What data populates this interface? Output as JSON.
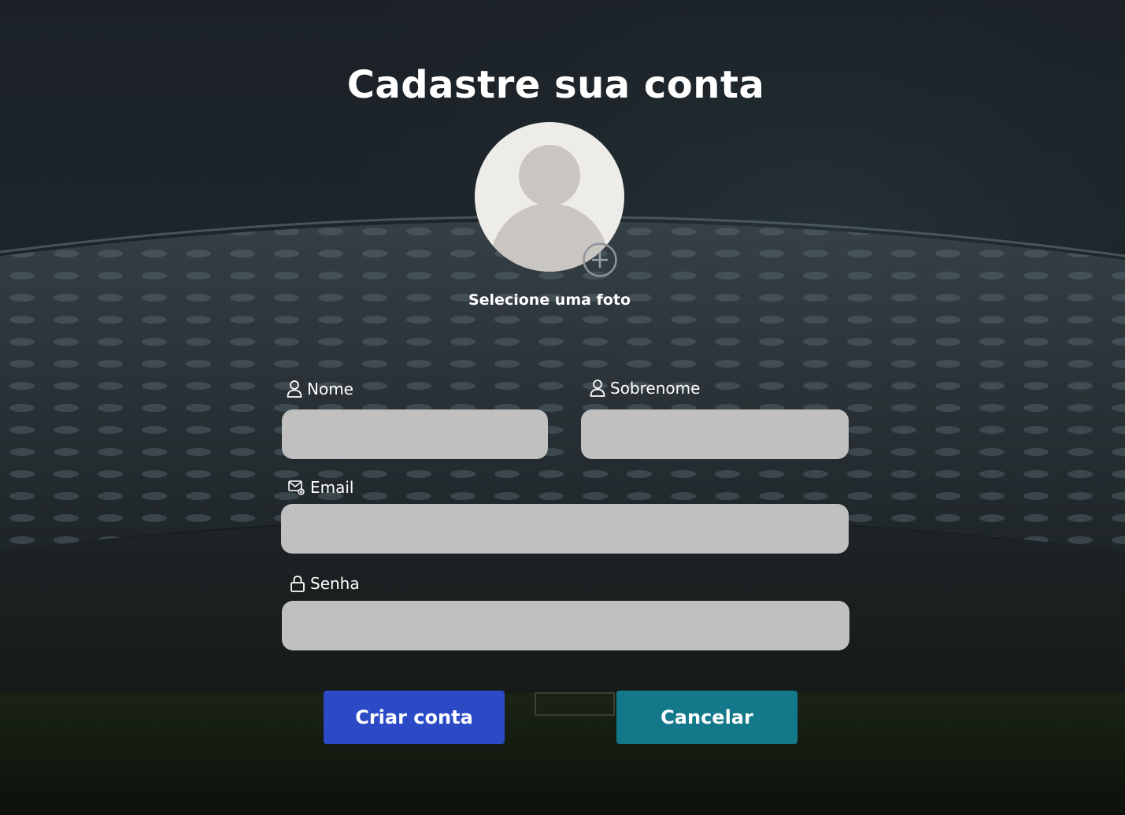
{
  "page": {
    "title": "Cadastre sua conta"
  },
  "photo": {
    "label": "Selecione uma foto",
    "add_icon": "plus-circle-icon",
    "avatar_icon": "user-silhouette-icon"
  },
  "form": {
    "first_name": {
      "label": "Nome",
      "icon": "user-icon",
      "value": ""
    },
    "last_name": {
      "label": "Sobrenome",
      "icon": "user-icon",
      "value": ""
    },
    "email": {
      "label": "Email",
      "icon": "mail-at-icon",
      "value": ""
    },
    "password": {
      "label": "Senha",
      "icon": "lock-icon",
      "value": ""
    }
  },
  "actions": {
    "create_label": "Criar conta",
    "cancel_label": "Cancelar"
  },
  "colors": {
    "primary_button": "#2c4ac6",
    "secondary_button": "#12788a",
    "input_background": "#c0c0c1"
  }
}
